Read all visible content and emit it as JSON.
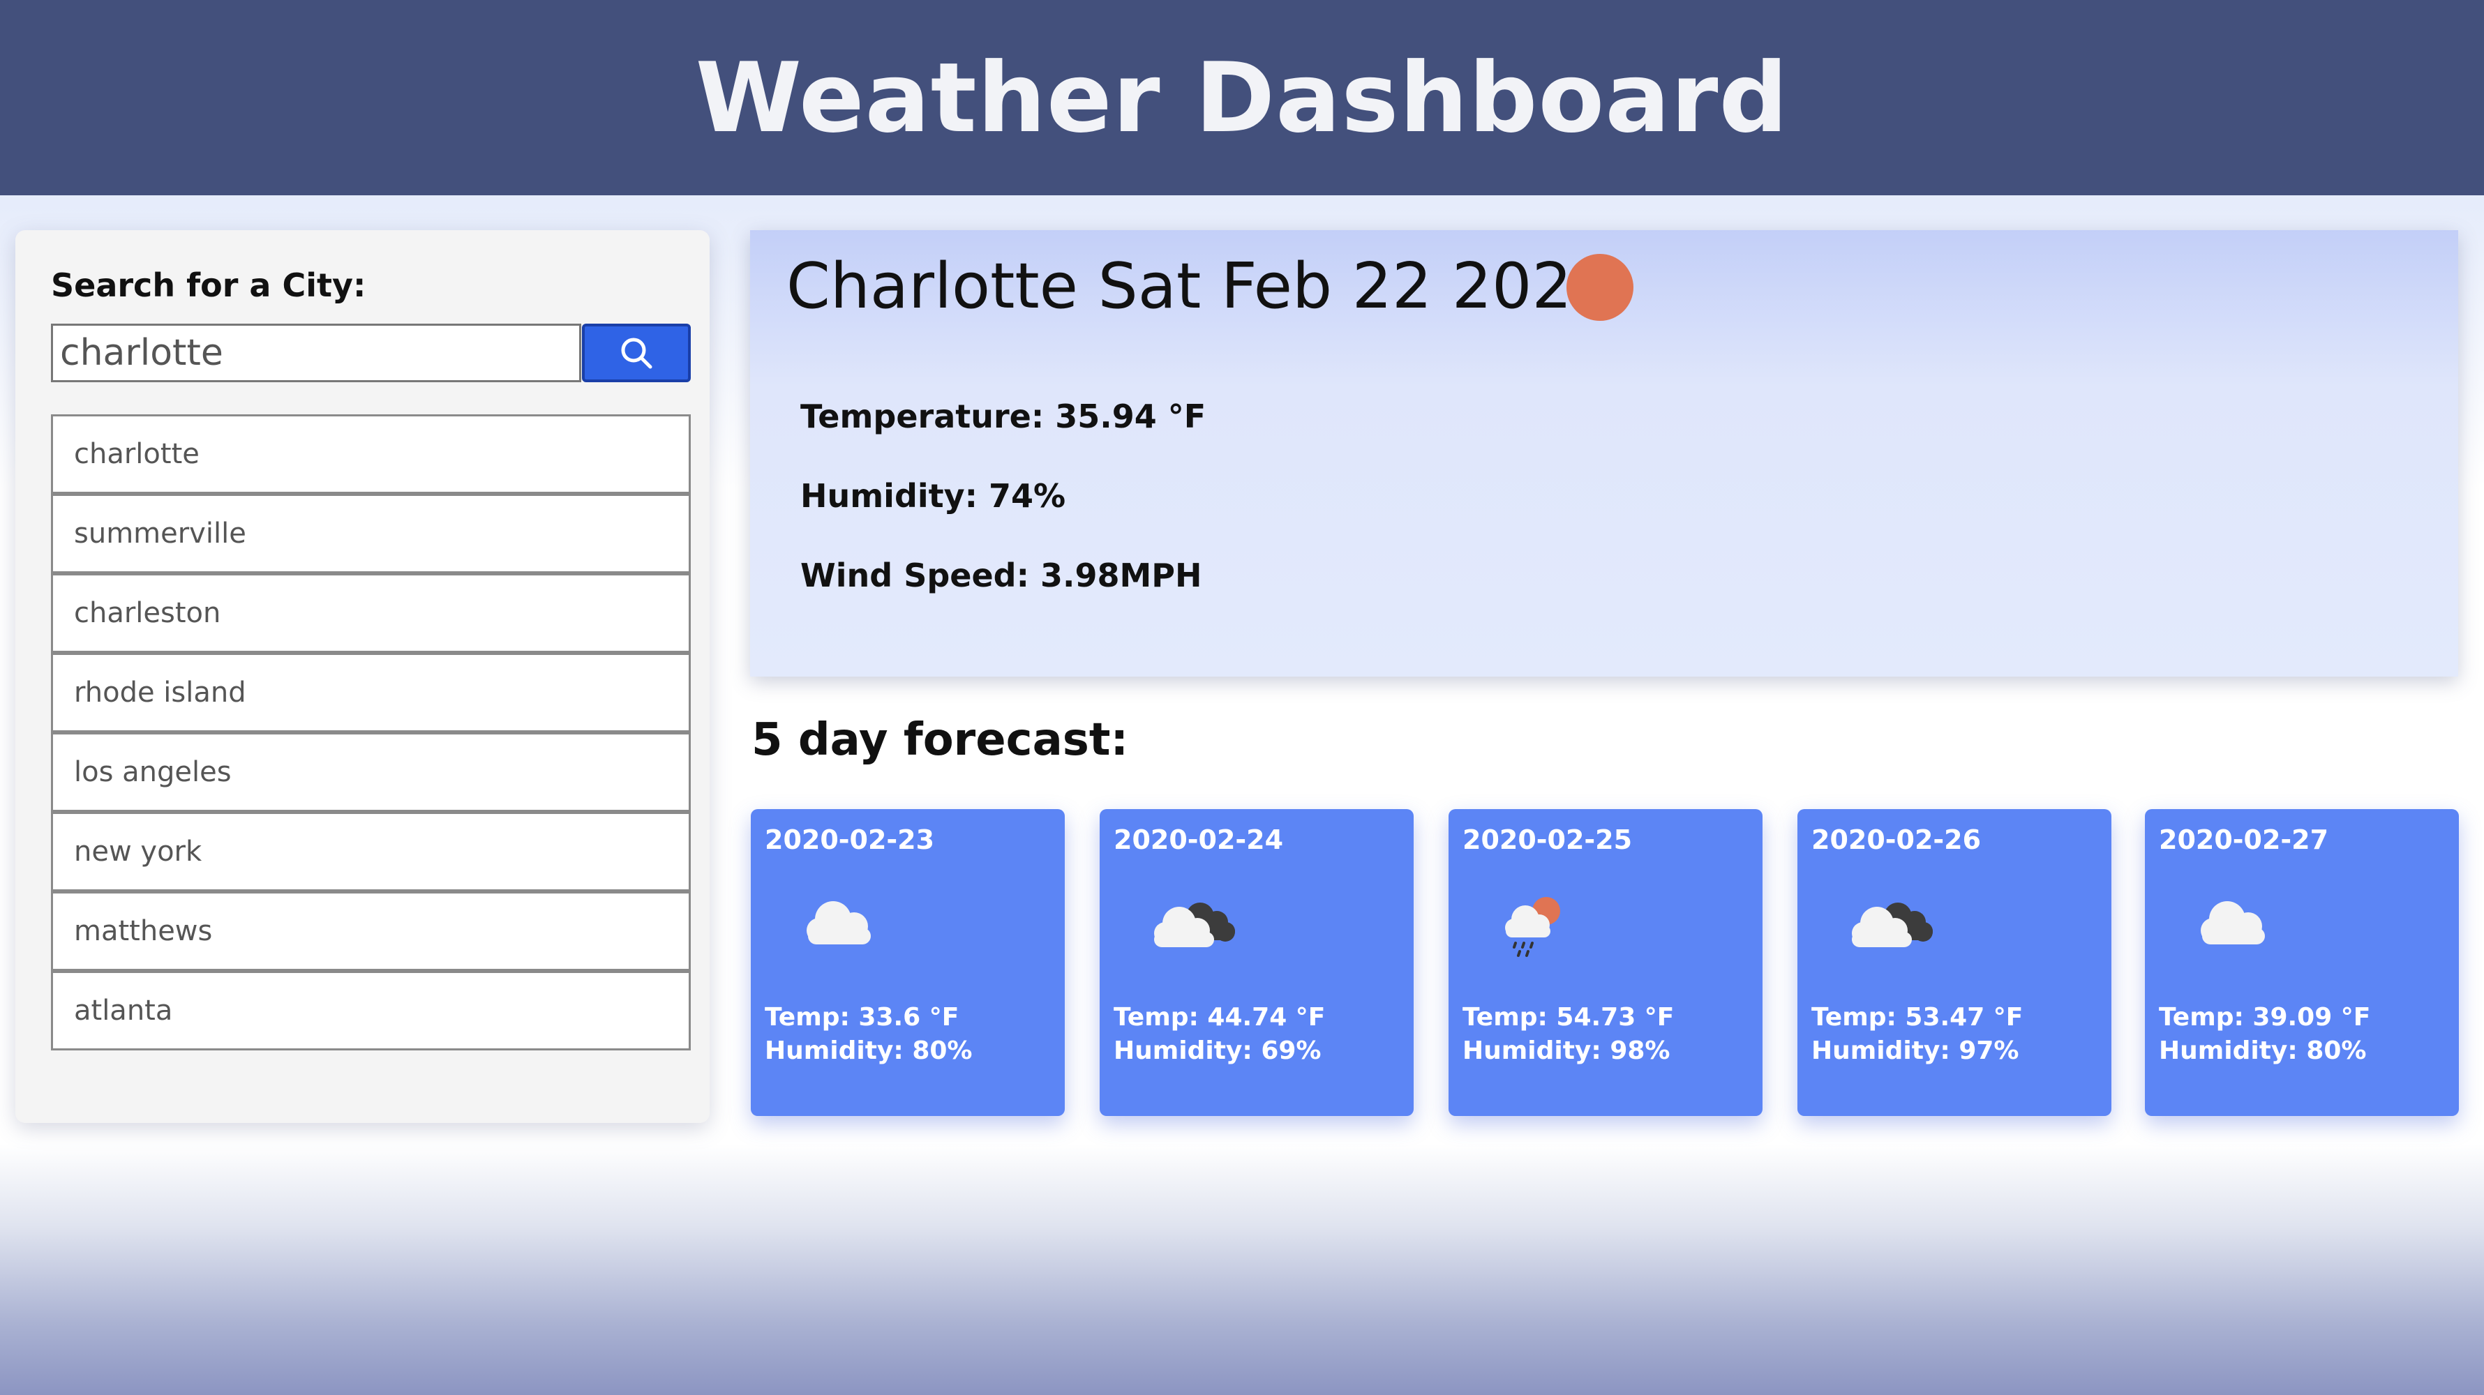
{
  "header": {
    "title": "Weather Dashboard"
  },
  "sidebar": {
    "search_label": "Search for a City:",
    "search_value": "charlotte",
    "search_button_icon": "search-icon",
    "history": [
      "charlotte",
      "summerville",
      "charleston",
      "rhode island",
      "los angeles",
      "new york",
      "matthews",
      "atlanta"
    ]
  },
  "current": {
    "title": "Charlotte Sat Feb 22 2020",
    "icon": "sun-icon",
    "temperature": "Temperature: 35.94 °F",
    "humidity": "Humidity: 74%",
    "wind": "Wind Speed: 3.98MPH"
  },
  "forecast": {
    "heading": "5 day forecast:",
    "days": [
      {
        "date": "2020-02-23",
        "icon": "cloud-icon",
        "temp": "Temp: 33.6 °F",
        "humidity": "Humidity: 80%"
      },
      {
        "date": "2020-02-24",
        "icon": "broken-clouds-icon",
        "temp": "Temp: 44.74 °F",
        "humidity": "Humidity: 69%"
      },
      {
        "date": "2020-02-25",
        "icon": "rain-sun-cloud-icon",
        "temp": "Temp: 54.73 °F",
        "humidity": "Humidity: 98%"
      },
      {
        "date": "2020-02-26",
        "icon": "broken-clouds-icon",
        "temp": "Temp: 53.47 °F",
        "humidity": "Humidity: 97%"
      },
      {
        "date": "2020-02-27",
        "icon": "cloud-icon",
        "temp": "Temp: 39.09 °F",
        "humidity": "Humidity: 80%"
      }
    ]
  },
  "colors": {
    "header_bg": "#43507c",
    "card_bg": "#5c85f5",
    "search_button": "#2f63e6",
    "sun": "#e07453"
  }
}
